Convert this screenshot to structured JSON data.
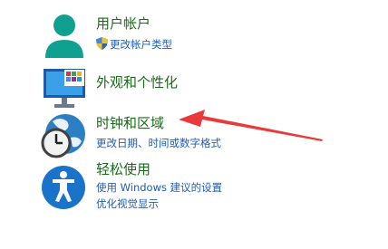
{
  "items": [
    {
      "title": "用户帐户",
      "links": [
        "更改帐户类型"
      ]
    },
    {
      "title": "外观和个性化",
      "links": []
    },
    {
      "title": "时钟和区域",
      "links": [
        "更改日期、时间或数字格式"
      ]
    },
    {
      "title": "轻松使用",
      "links": [
        "使用 Windows 建议的设置",
        "优化视觉显示"
      ]
    }
  ],
  "colors": {
    "title_green": "#1a6b1a",
    "link_blue": "#1f5db5",
    "annotation_arrow": "#e83a3a"
  },
  "icons": [
    "user-accounts-icon",
    "appearance-personalization-icon",
    "clock-region-icon",
    "ease-of-access-icon",
    "uac-shield-icon",
    "red-arrow-annotation"
  ]
}
